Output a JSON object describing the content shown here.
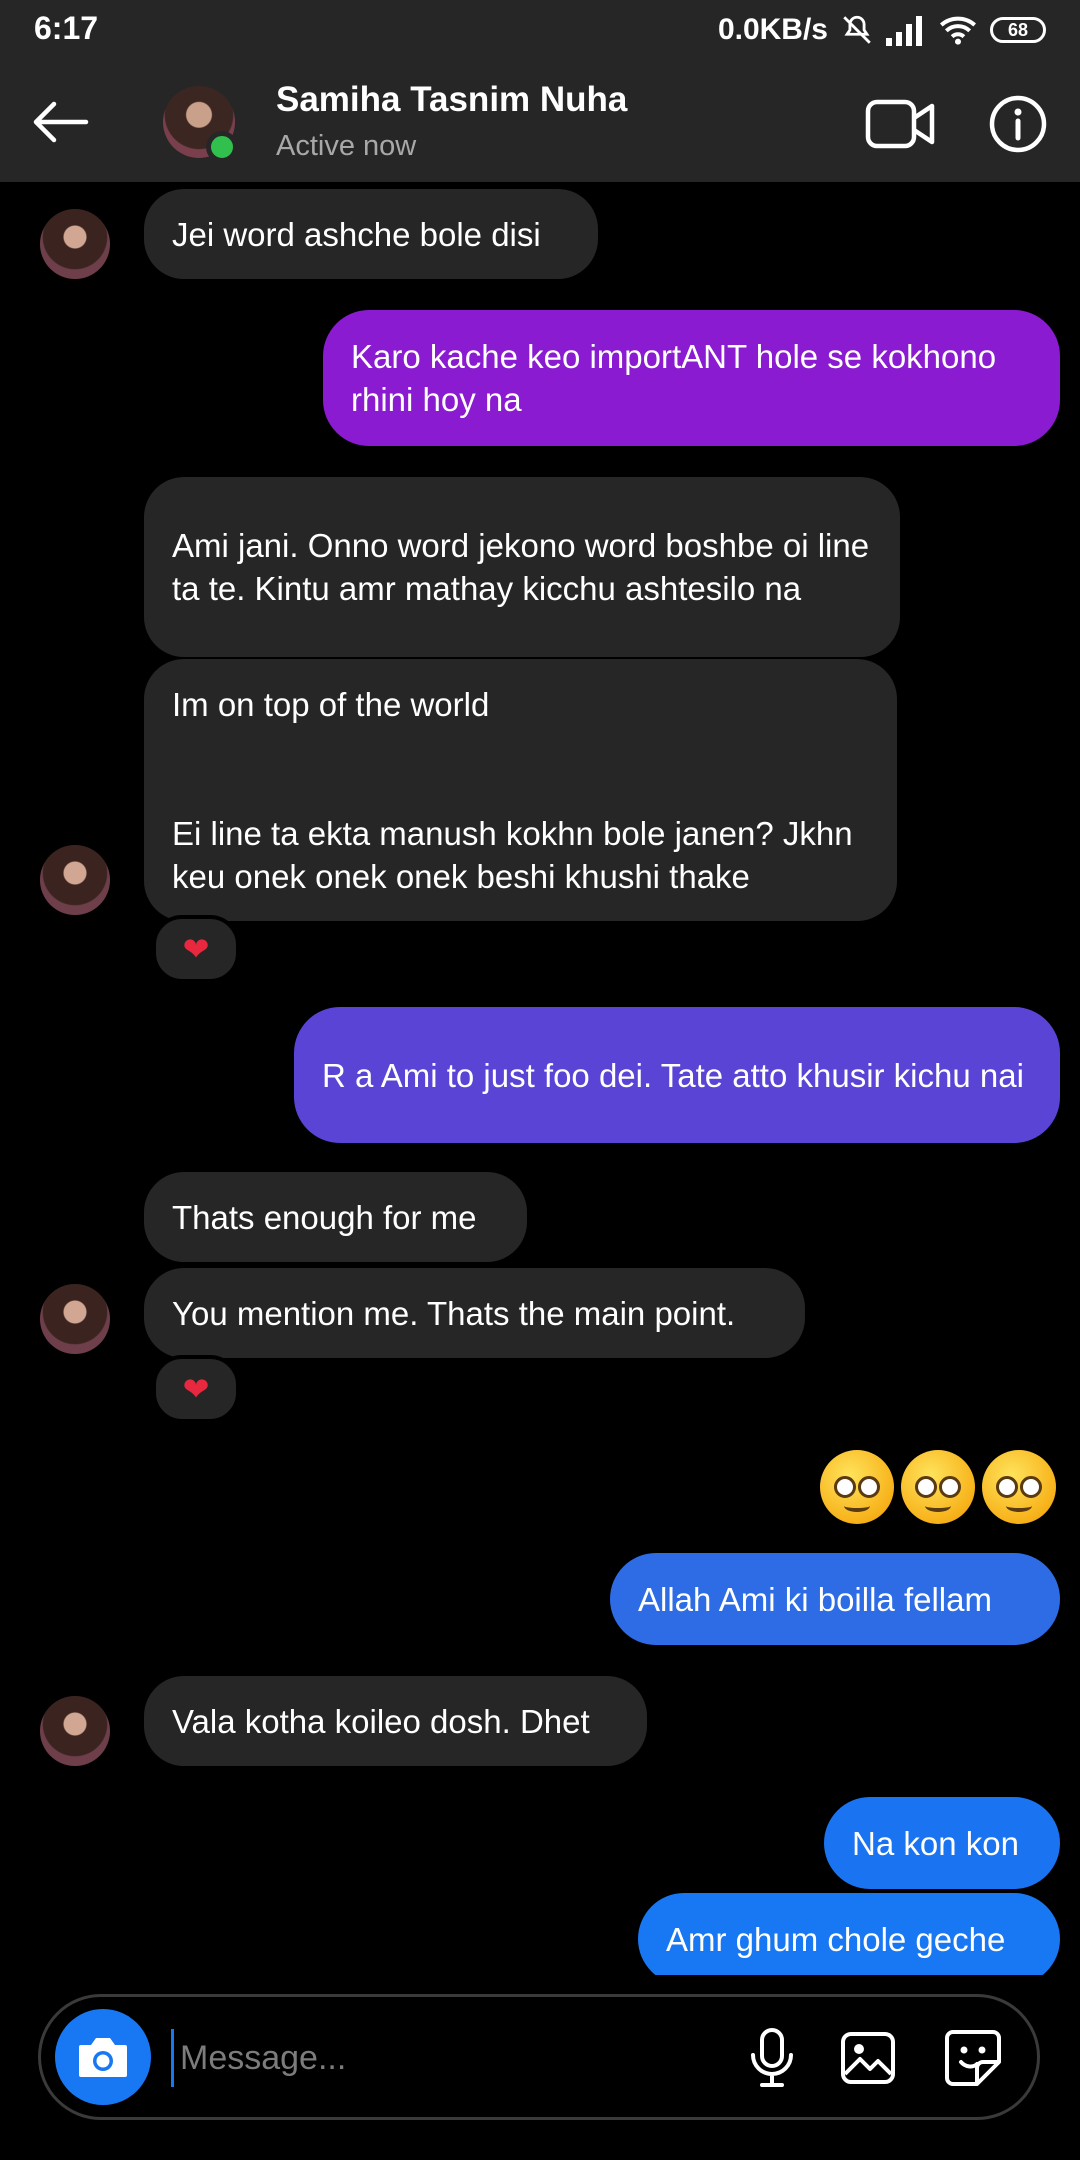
{
  "status_bar": {
    "time": "6:17",
    "network_speed": "0.0KB/s",
    "battery": "68"
  },
  "header": {
    "contact_name": "Samiha Tasnim Nuha",
    "status": "Active now"
  },
  "messages": [
    {
      "from": "contact",
      "text": "Jei word ashche bole disi"
    },
    {
      "from": "me",
      "text": "Karo kache keo importANT hole se kokhono rhini hoy na",
      "color": "#8a1bd0"
    },
    {
      "from": "contact",
      "text": "Ami jani. Onno word jekono word boshbe oi line ta te. Kintu amr mathay kicchu ashtesilo na"
    },
    {
      "from": "contact",
      "text": "Im on top of the world\n\n\nEi line ta ekta manush kokhn bole janen? Jkhn keu onek onek onek beshi khushi thake",
      "reaction": "❤"
    },
    {
      "from": "me",
      "text": "R a Ami to just foo dei. Tate atto khusir kichu nai",
      "color": "#5a44d6"
    },
    {
      "from": "contact",
      "text": "Thats enough for me"
    },
    {
      "from": "contact",
      "text": "You mention me. Thats the main point.",
      "reaction": "❤"
    },
    {
      "from": "me",
      "emoji": [
        "woozy-face",
        "woozy-face",
        "woozy-face"
      ]
    },
    {
      "from": "me",
      "text": "Allah Ami ki boilla fellam",
      "color": "#2d6ce5"
    },
    {
      "from": "contact",
      "text": "Vala kotha koileo dosh. Dhet"
    },
    {
      "from": "me",
      "text": "Na kon kon",
      "color": "#1a73f0"
    },
    {
      "from": "me",
      "text": "Amr ghum chole geche",
      "color": "#1877f2"
    }
  ],
  "composer": {
    "placeholder": "Message..."
  }
}
